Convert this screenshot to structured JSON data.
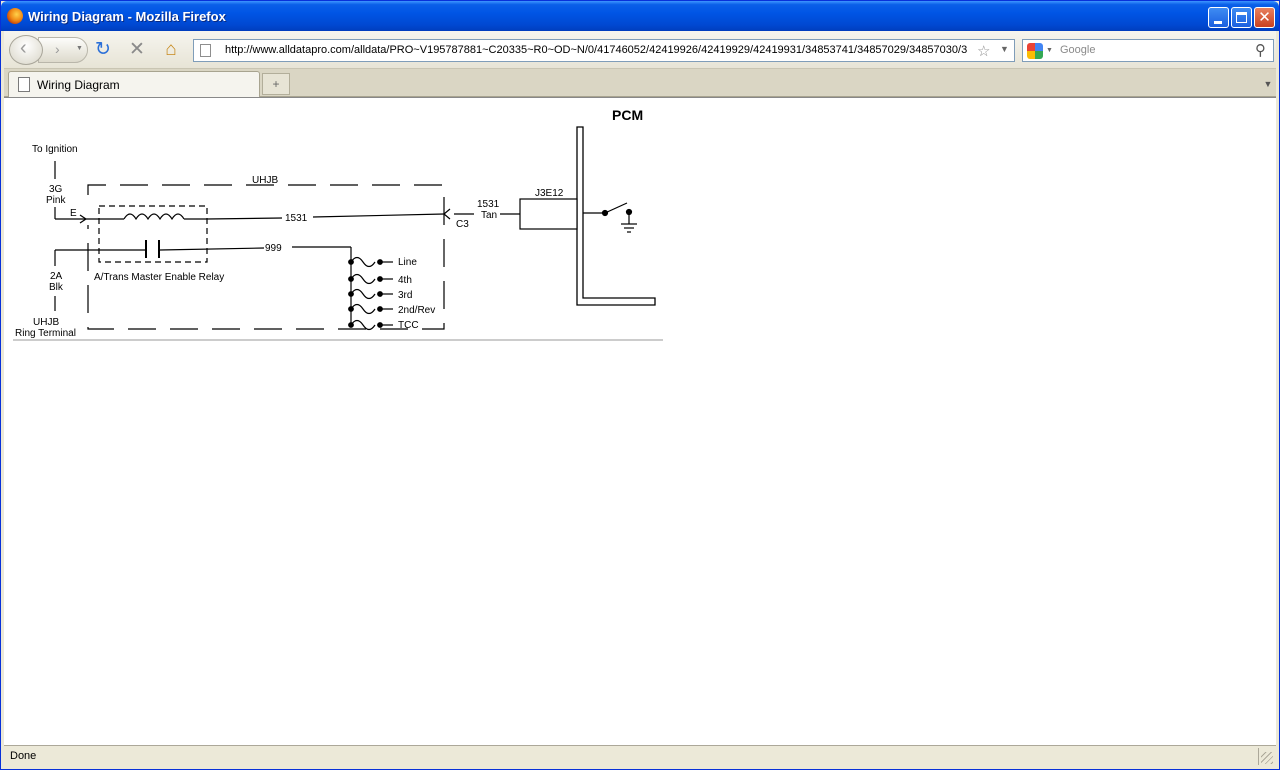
{
  "window": {
    "title": "Wiring Diagram - Mozilla Firefox"
  },
  "navbar": {
    "url": "http://www.alldatapro.com/alldata/PRO~V195787881~C20335~R0~OD~N/0/41746052/42419926/42419929/42419931/34853741/34857029/34857030/3",
    "search_placeholder": "Google"
  },
  "tabs": [
    {
      "label": "Wiring Diagram"
    }
  ],
  "status": {
    "text": "Done"
  },
  "diagram": {
    "pcm": "PCM",
    "to_ignition": "To Ignition",
    "circuit_3g": "3G",
    "pink": "Pink",
    "pin_e": "E",
    "uhjb_top": "UHJB",
    "wire_1531": "1531",
    "wire_999": "999",
    "c3": "C3",
    "tan_num": "1531",
    "tan": "Tan",
    "j3e12": "J3E12",
    "circuit_2a": "2A",
    "blk": "Blk",
    "relay": "A/Trans Master Enable Relay",
    "uhjb_bottom": "UHJB",
    "ring_terminal": "Ring Terminal",
    "fuses": [
      "Line",
      "4th",
      "3rd",
      "2nd/Rev",
      "TCC"
    ]
  }
}
